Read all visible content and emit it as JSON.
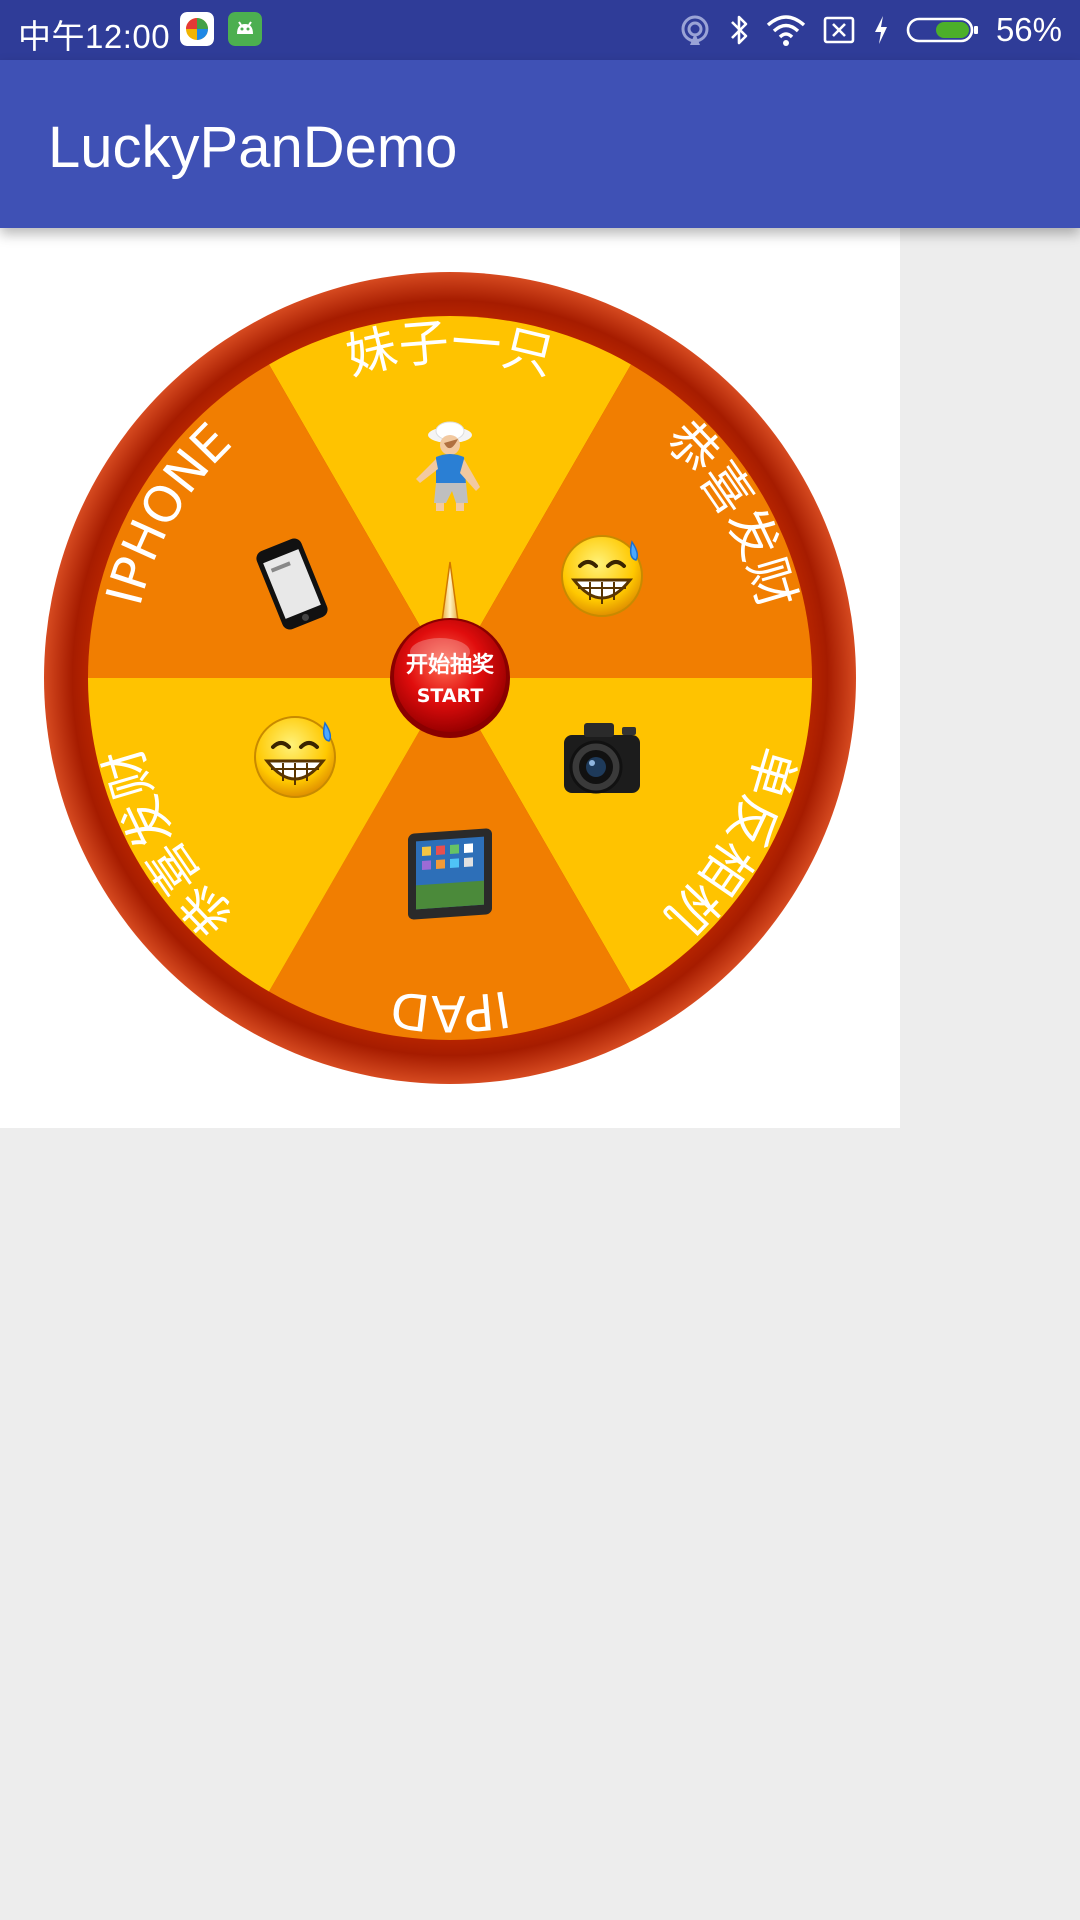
{
  "status_bar": {
    "time": "中午12:00",
    "battery_percent": "56%",
    "icons": [
      "app-360-icon",
      "app-android-icon",
      "hotspot-icon",
      "bluetooth-icon",
      "wifi-icon",
      "no-sim-icon",
      "charging-icon",
      "battery-icon"
    ]
  },
  "app_bar": {
    "title": "LuckyPanDemo",
    "color": "#3f51b5"
  },
  "wheel": {
    "sectors": [
      {
        "label": "妹子一只",
        "icon": "girl-photo-icon",
        "color": "#ffc300"
      },
      {
        "label": "恭喜发财",
        "icon": "smiley-icon",
        "color": "#f17e01"
      },
      {
        "label": "单反相机",
        "icon": "camera-icon",
        "color": "#ffc300"
      },
      {
        "label": "IPAD",
        "icon": "ipad-icon",
        "color": "#f17e01"
      },
      {
        "label": "恭喜发财",
        "icon": "smiley-icon",
        "color": "#ffc300"
      },
      {
        "label": "IPHONE",
        "icon": "iphone-icon",
        "color": "#f17e01"
      }
    ],
    "start_button": {
      "label_cn": "开始抽奖",
      "label_en": "START"
    },
    "rim_color": "#b11d00"
  }
}
